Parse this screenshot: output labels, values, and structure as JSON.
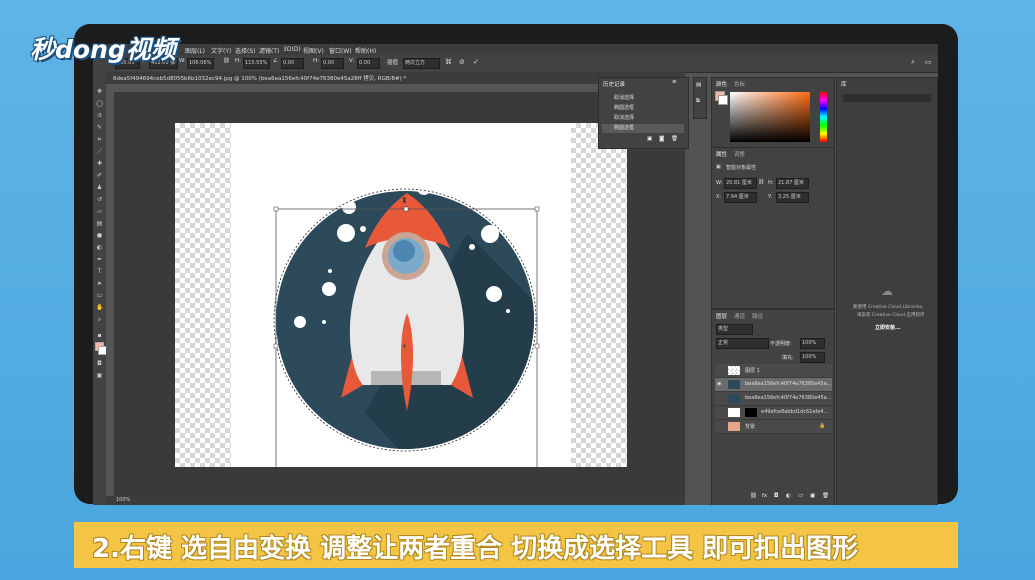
{
  "logo": {
    "text": "秒dong视频"
  },
  "menu": [
    "图层(L)",
    "文字(Y)",
    "选择(S)",
    "滤镜(T)",
    "3D(D)",
    "视图(V)",
    "窗口(W)",
    "帮助(H)"
  ],
  "options": {
    "x_value": "500.00",
    "y_value": "402.00 像",
    "w_value": "106.06%",
    "h_value": "115.55%",
    "angle_value": "0.00",
    "h_skew": "0.00",
    "v_skew": "0.00",
    "interp_label": "插值",
    "interp_value": "两次立方"
  },
  "document_tab": "6dea5f494694ceb5d8055b6b1032ec94.jpg @ 100% (bea6ea156efc40f74e76380e45a28ff 拷贝, RGB/8#) *",
  "status_zoom": "100%",
  "history": {
    "title": "历史记录",
    "items": [
      "取消选择",
      "椭圆选框",
      "取消选择",
      "椭圆选框"
    ]
  },
  "color_panel": {
    "tabs": [
      "颜色",
      "色板"
    ]
  },
  "properties": {
    "tabs": [
      "属性",
      "调整"
    ],
    "heading": "智能对象属性",
    "w": "20.81 厘米",
    "h": "21.87 厘米",
    "x": "7.94 厘米",
    "y": "3.25 厘米"
  },
  "library": {
    "tab": "库",
    "msg1": "要使用 Creative Cloud Libraries,",
    "msg2": "请安装 Creative Cloud 应用程序",
    "link": "立即安装..."
  },
  "layers": {
    "tabs": [
      "图层",
      "通道",
      "路径"
    ],
    "kind": "类型",
    "mode": "正常",
    "opacity_label": "不透明度:",
    "opacity": "100%",
    "fill_label": "填充:",
    "fill": "100%",
    "items": [
      {
        "name": "图层 1"
      },
      {
        "name": "bea6ea156efc40f74e76380e45a..."
      },
      {
        "name": "bea6ea156efc40f74e76380e45a..."
      },
      {
        "name": "e49efce8abbd1dc61efe4..."
      },
      {
        "name": "背景"
      }
    ]
  },
  "caption": "2.右键 选自由变换 调整让两者重合 切换成选择工具 即可扣出图形",
  "colors": {
    "rocket_bg": "#2c4a5a",
    "rocket_red": "#e8593a",
    "caption_bg": "#f4c544"
  }
}
